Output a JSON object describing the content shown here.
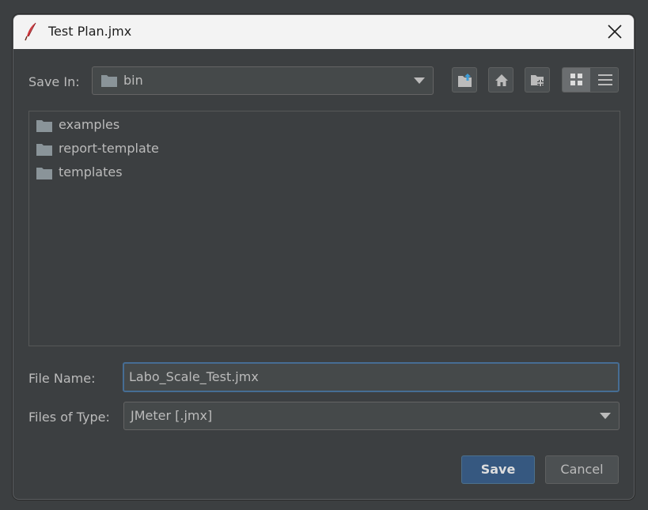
{
  "window": {
    "title": "Test Plan.jmx"
  },
  "save_in": {
    "label": "Save In:",
    "value": "bin"
  },
  "toolbar": {
    "up_icon": "up-folder-icon",
    "home_icon": "home-icon",
    "new_folder_icon": "new-folder-icon",
    "list_view_icon": "list-view-icon",
    "details_view_icon": "details-view-icon",
    "active_view": "list"
  },
  "files": [
    {
      "name": "examples",
      "icon": "folder-icon"
    },
    {
      "name": "report-template",
      "icon": "folder-icon"
    },
    {
      "name": "templates",
      "icon": "folder-icon"
    }
  ],
  "file_name": {
    "label": "File Name:",
    "value": "Labo_Scale_Test.jmx"
  },
  "file_type": {
    "label": "Files of Type:",
    "value": "JMeter [.jmx]"
  },
  "buttons": {
    "save": "Save",
    "cancel": "Cancel"
  },
  "colors": {
    "background": "#3c3f41",
    "titlebar": "#f3f3f3",
    "accent": "#365880",
    "focus_border": "#466d94",
    "folder": "#8a9499",
    "up_arrow": "#3c9dd8"
  }
}
